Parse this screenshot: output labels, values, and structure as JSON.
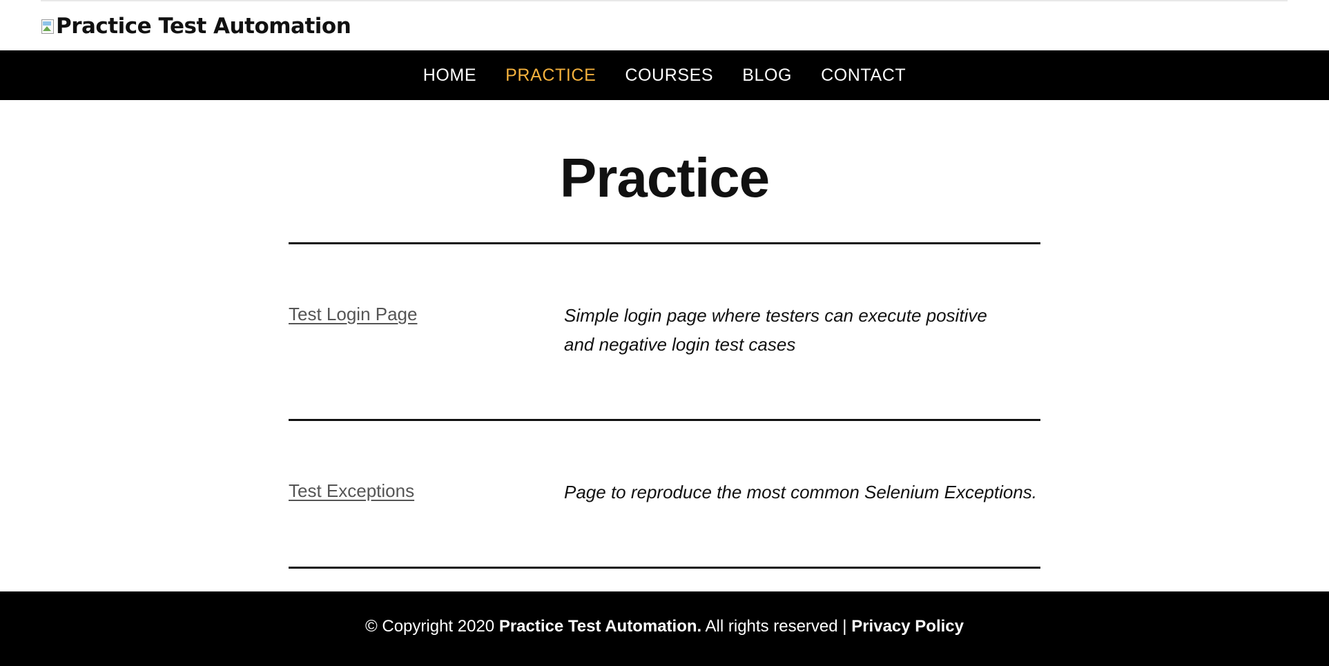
{
  "header": {
    "logo_text": "Practice Test Automation",
    "logo_icon": "broken-image-icon"
  },
  "nav": {
    "items": [
      {
        "label": "HOME",
        "active": false
      },
      {
        "label": "PRACTICE",
        "active": true
      },
      {
        "label": "COURSES",
        "active": false
      },
      {
        "label": "BLOG",
        "active": false
      },
      {
        "label": "CONTACT",
        "active": false
      }
    ],
    "active_color": "#f4b13d"
  },
  "main": {
    "title": "Practice",
    "rows": [
      {
        "link": "Test Login Page",
        "description": "Simple login page where testers can execute positive and negative login test cases"
      },
      {
        "link": "Test Exceptions",
        "description": "Page to reproduce the most common Selenium Exceptions."
      }
    ]
  },
  "footer": {
    "copyright_prefix": "© Copyright 2020",
    "site_name": "Practice Test Automation.",
    "rights_text": "All rights reserved |",
    "privacy_link": "Privacy Policy"
  }
}
